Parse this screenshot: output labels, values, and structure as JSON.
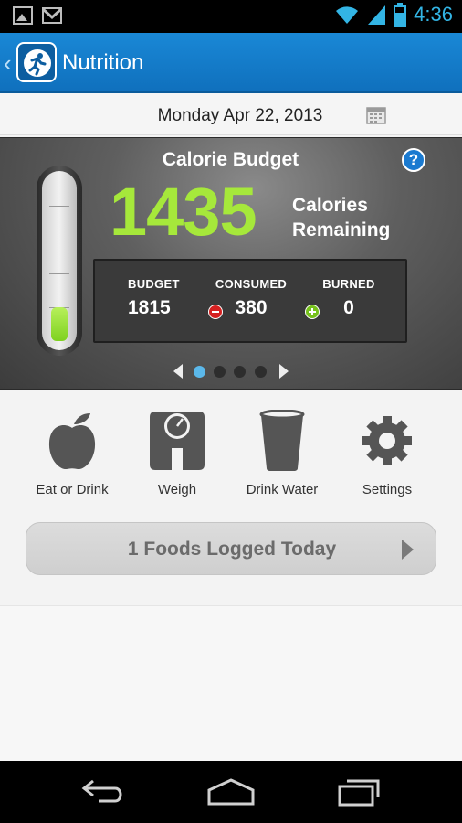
{
  "status_bar": {
    "time": "4:36",
    "icons": [
      "image-icon",
      "gmail-icon",
      "wifi-icon",
      "signal-icon",
      "battery-icon"
    ]
  },
  "action_bar": {
    "title": "Nutrition"
  },
  "date": "Monday Apr 22, 2013",
  "calorie_budget": {
    "title": "Calorie Budget",
    "remaining_value": "1435",
    "remaining_label_line1": "Calories",
    "remaining_label_line2": "Remaining",
    "budget_label": "BUDGET",
    "budget_value": "1815",
    "consumed_label": "CONSUMED",
    "consumed_value": "380",
    "burned_label": "BURNED",
    "burned_value": "0",
    "meter_fraction": 0.21,
    "pager": {
      "page_count": 4,
      "active_index": 0
    },
    "colors": {
      "remaining_green": "#a6e83b",
      "consumed_red": "#d52020",
      "burned_green": "#76c11c",
      "active_dot": "#5bb8ea"
    }
  },
  "actions": [
    {
      "label": "Eat or Drink",
      "icon": "apple-icon"
    },
    {
      "label": "Weigh",
      "icon": "scale-icon"
    },
    {
      "label": "Drink Water",
      "icon": "glass-icon"
    },
    {
      "label": "Settings",
      "icon": "gear-icon"
    }
  ],
  "foods_logged": "1 Foods Logged Today",
  "nav": [
    "back-icon",
    "home-icon",
    "recent-apps-icon"
  ]
}
